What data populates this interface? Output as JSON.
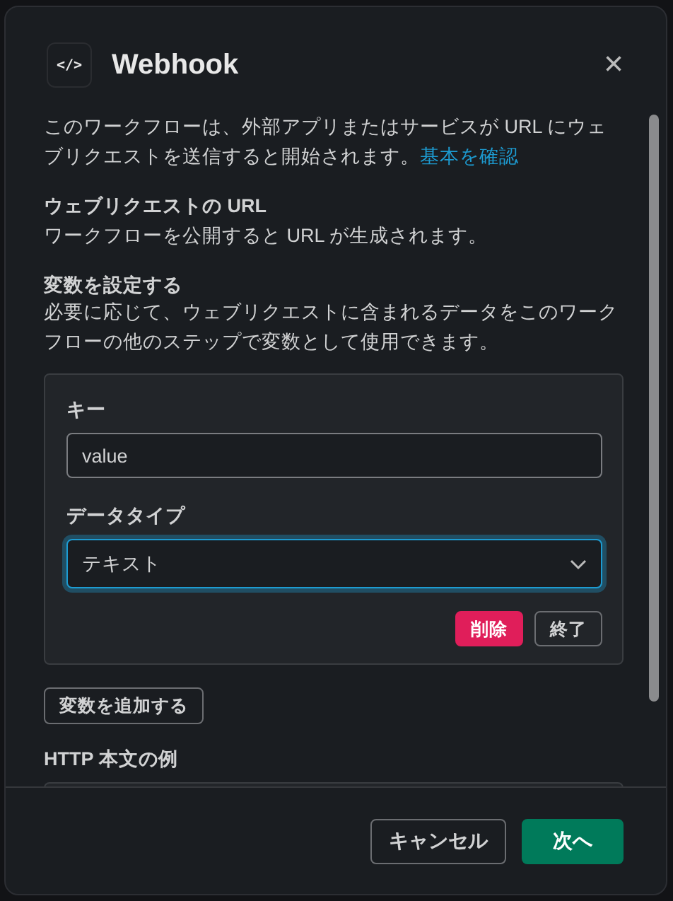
{
  "dialog": {
    "icon_text": "</>",
    "title": "Webhook",
    "close": "×"
  },
  "intro": {
    "text": "このワークフローは、外部アプリまたはサービスが URL にウェブリクエストを送信すると開始されます。",
    "link": "基本を確認"
  },
  "url_section": {
    "heading": "ウェブリクエストの URL",
    "text": "ワークフローを公開すると URL が生成されます。"
  },
  "variables_section": {
    "heading": "変数を設定する",
    "text": "必要に応じて、ウェブリクエストに含まれるデータをこのワークフローの他のステップで変数として使用できます。"
  },
  "variable": {
    "key_label": "キー",
    "key_value": "value",
    "type_label": "データタイプ",
    "type_value": "テキスト",
    "type_focused": true,
    "delete_button": "削除",
    "done_button": "終了"
  },
  "add_variable_button": "変数を追加する",
  "http_example": {
    "heading": "HTTP 本文の例"
  },
  "footer": {
    "buttons": [
      {
        "label": "キャンセル",
        "kind": "secondary"
      },
      {
        "label": "次へ",
        "kind": "primary"
      }
    ]
  }
}
